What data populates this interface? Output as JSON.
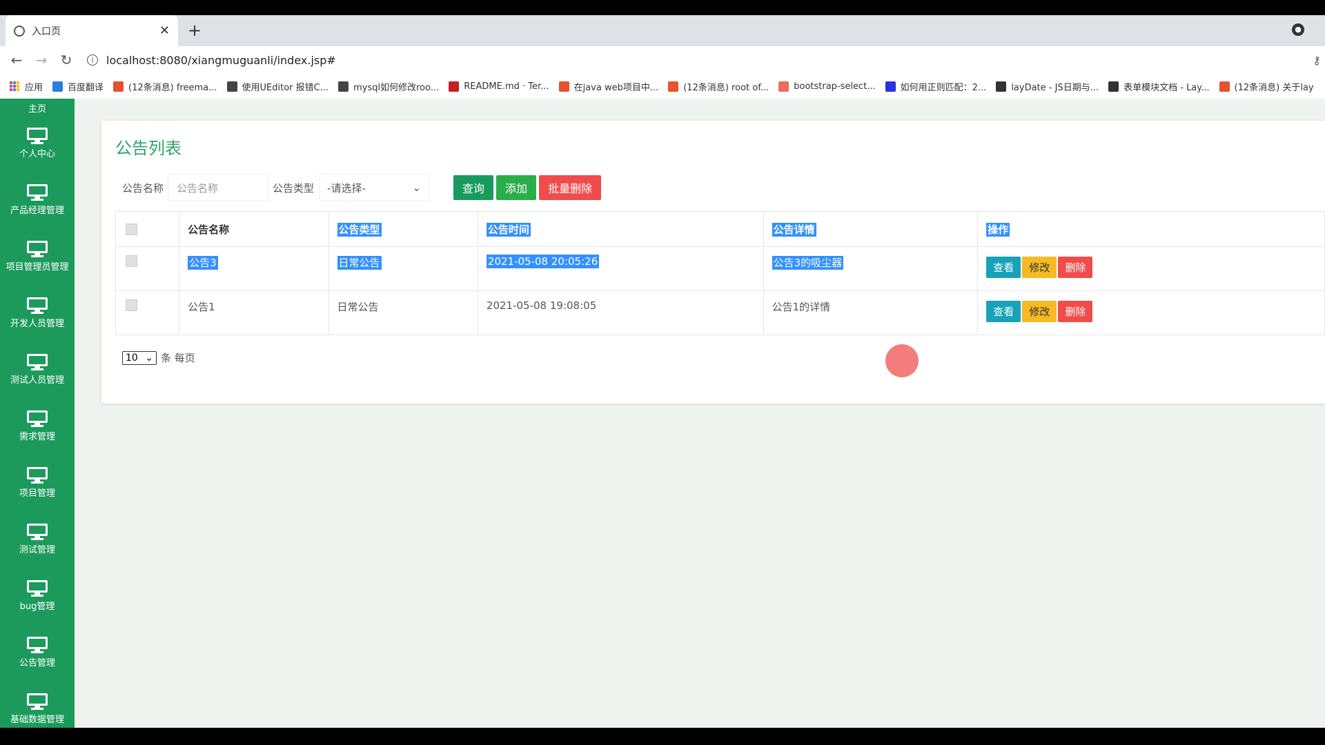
{
  "browser": {
    "tab_title": "入口页",
    "url": "localhost:8080/xiangmuguanli/index.jsp#",
    "bookmarks": [
      {
        "label": "应用",
        "icon": "apps-grid-icon"
      },
      {
        "label": "百度翻译",
        "icon": "translate-icon",
        "color": "#2a7de1"
      },
      {
        "label": "(12条消息) freema...",
        "icon": "csdn-icon",
        "color": "#e8512c"
      },
      {
        "label": "使用UEditor 报错C...",
        "icon": "github-icon",
        "color": "#444444"
      },
      {
        "label": "mysql如何修改roo...",
        "icon": "github-icon",
        "color": "#444444"
      },
      {
        "label": "README.md · Ter...",
        "icon": "gitee-icon",
        "color": "#c71d23"
      },
      {
        "label": "在java web项目中...",
        "icon": "csdn-icon",
        "color": "#e8512c"
      },
      {
        "label": "(12条消息) root of...",
        "icon": "csdn-icon",
        "color": "#e8512c"
      },
      {
        "label": "bootstrap-select...",
        "icon": "jianshu-icon",
        "color": "#ea6f5a"
      },
      {
        "label": "如何用正则匹配：2...",
        "icon": "baidu-icon",
        "color": "#2932e1"
      },
      {
        "label": "layDate - JS日期与...",
        "icon": "layui-icon",
        "color": "#333333"
      },
      {
        "label": "表单模块文档 - Lay...",
        "icon": "layui-icon",
        "color": "#333333"
      },
      {
        "label": "(12条消息) 关于lay",
        "icon": "csdn-icon",
        "color": "#e8512c"
      }
    ]
  },
  "sidebar": {
    "top_label": "主页",
    "items": [
      {
        "label": "个人中心"
      },
      {
        "label": "产品经理管理"
      },
      {
        "label": "项目管理员管理"
      },
      {
        "label": "开发人员管理"
      },
      {
        "label": "测试人员管理"
      },
      {
        "label": "需求管理"
      },
      {
        "label": "项目管理"
      },
      {
        "label": "测试管理"
      },
      {
        "label": "bug管理"
      },
      {
        "label": "公告管理"
      },
      {
        "label": "基础数据管理"
      }
    ]
  },
  "panel": {
    "title": "公告列表",
    "search": {
      "name_label": "公告名称",
      "name_placeholder": "公告名称",
      "type_label": "公告类型",
      "type_selected": "-请选择-",
      "query_button": "查询",
      "add_button": "添加",
      "batch_delete_button": "批量删除"
    },
    "table": {
      "headers": [
        "公告名称",
        "公告类型",
        "公告时间",
        "公告详情",
        "操作"
      ],
      "rows": [
        {
          "name": "公告3",
          "type": "日常公告",
          "time": "2021-05-08 20:05:26",
          "detail": "公告3的吸尘器",
          "selected_text": true
        },
        {
          "name": "公告1",
          "type": "日常公告",
          "time": "2021-05-08 19:08:05",
          "detail": "公告1的详情",
          "selected_text": false
        }
      ],
      "actions": {
        "view": "查看",
        "edit": "修改",
        "delete": "删除"
      }
    },
    "pager": {
      "page_size": "10",
      "suffix": "条 每页"
    }
  },
  "colors": {
    "sidebar": "#1c9a5c",
    "title": "#2ea36a",
    "query": "#179c5e",
    "add": "#2aae4a",
    "danger": "#f14b4b",
    "view": "#18a2b8",
    "edit": "#f7b924",
    "selection": "#3390ff"
  }
}
